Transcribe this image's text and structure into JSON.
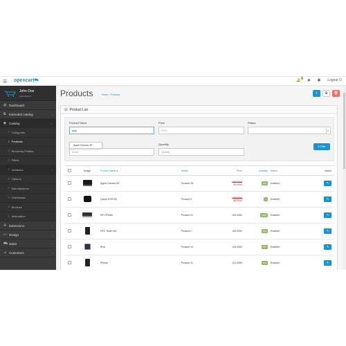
{
  "header": {
    "logo": "opencart",
    "logout": "Logout",
    "notif_count": "1"
  },
  "user": {
    "name": "John Doe",
    "role": "Administrator"
  },
  "sidebar": {
    "items": [
      {
        "label": "Dashboard",
        "icon": "dashboard-icon"
      },
      {
        "label": "Extended catalog",
        "icon": "tags-icon"
      },
      {
        "label": "Catalog",
        "icon": "tag-icon"
      }
    ],
    "sub": [
      {
        "label": "Categories"
      },
      {
        "label": "Products"
      },
      {
        "label": "Recurring Profiles"
      },
      {
        "label": "Filters"
      },
      {
        "label": "Attributes"
      },
      {
        "label": "Options"
      },
      {
        "label": "Manufacturers"
      },
      {
        "label": "Downloads"
      },
      {
        "label": "Reviews"
      },
      {
        "label": "Information"
      }
    ],
    "bottom": [
      {
        "label": "Extensions",
        "icon": "puzzle-icon"
      },
      {
        "label": "Design",
        "icon": "monitor-icon"
      },
      {
        "label": "Sales",
        "icon": "cart-icon"
      },
      {
        "label": "Customers",
        "icon": "user-icon"
      }
    ]
  },
  "page": {
    "title": "Products",
    "crumb_home": "Home",
    "crumb_current": "Products",
    "panel_title": "Product List"
  },
  "filter": {
    "name_label": "Product Name",
    "name_value": "App|",
    "price_label": "Price",
    "price_placeholder": "Price",
    "status_label": "Status",
    "model_label": "Model",
    "model_placeholder": "Model",
    "quantity_label": "Quantity",
    "quantity_placeholder": "Quantity",
    "suggestion": "Apple Cinema 30\"",
    "filter_button": "Filter"
  },
  "table": {
    "headers": {
      "image": "Image",
      "name": "Product Name",
      "model": "Model",
      "price": "Price",
      "quantity": "Quantity",
      "status": "Status",
      "action": "Action"
    },
    "rows": [
      {
        "name": "Apple Cinema 30\"",
        "model": "Product 15",
        "price": "100.0000",
        "special": "90.0000",
        "quantity": "990",
        "qcolor": "green",
        "status": "Enabled",
        "thumb": "tv"
      },
      {
        "name": "Canon EOS 5D",
        "model": "Product 3",
        "price": "100.0000",
        "special": "80.0000",
        "quantity": "7",
        "qcolor": "green",
        "status": "Enabled",
        "thumb": "cam"
      },
      {
        "name": "HP LP3065",
        "model": "Product 21",
        "price": "100.0000",
        "special": "",
        "quantity": "1000",
        "qcolor": "green",
        "status": "Enabled",
        "thumb": "lap"
      },
      {
        "name": "HTC Touch HD",
        "model": "Product 1",
        "price": "100.0000",
        "special": "",
        "quantity": "939",
        "qcolor": "green",
        "status": "Enabled",
        "thumb": "ph"
      },
      {
        "name": "iPod",
        "model": "Product 14",
        "price": "100.0000",
        "special": "",
        "quantity": "977",
        "qcolor": "green",
        "status": "Enabled",
        "thumb": "ip"
      },
      {
        "name": "iPhone",
        "model": "Product 11",
        "price": "101.0000",
        "special": "",
        "quantity": "970",
        "qcolor": "green",
        "status": "Enabled",
        "thumb": "ph"
      }
    ]
  }
}
